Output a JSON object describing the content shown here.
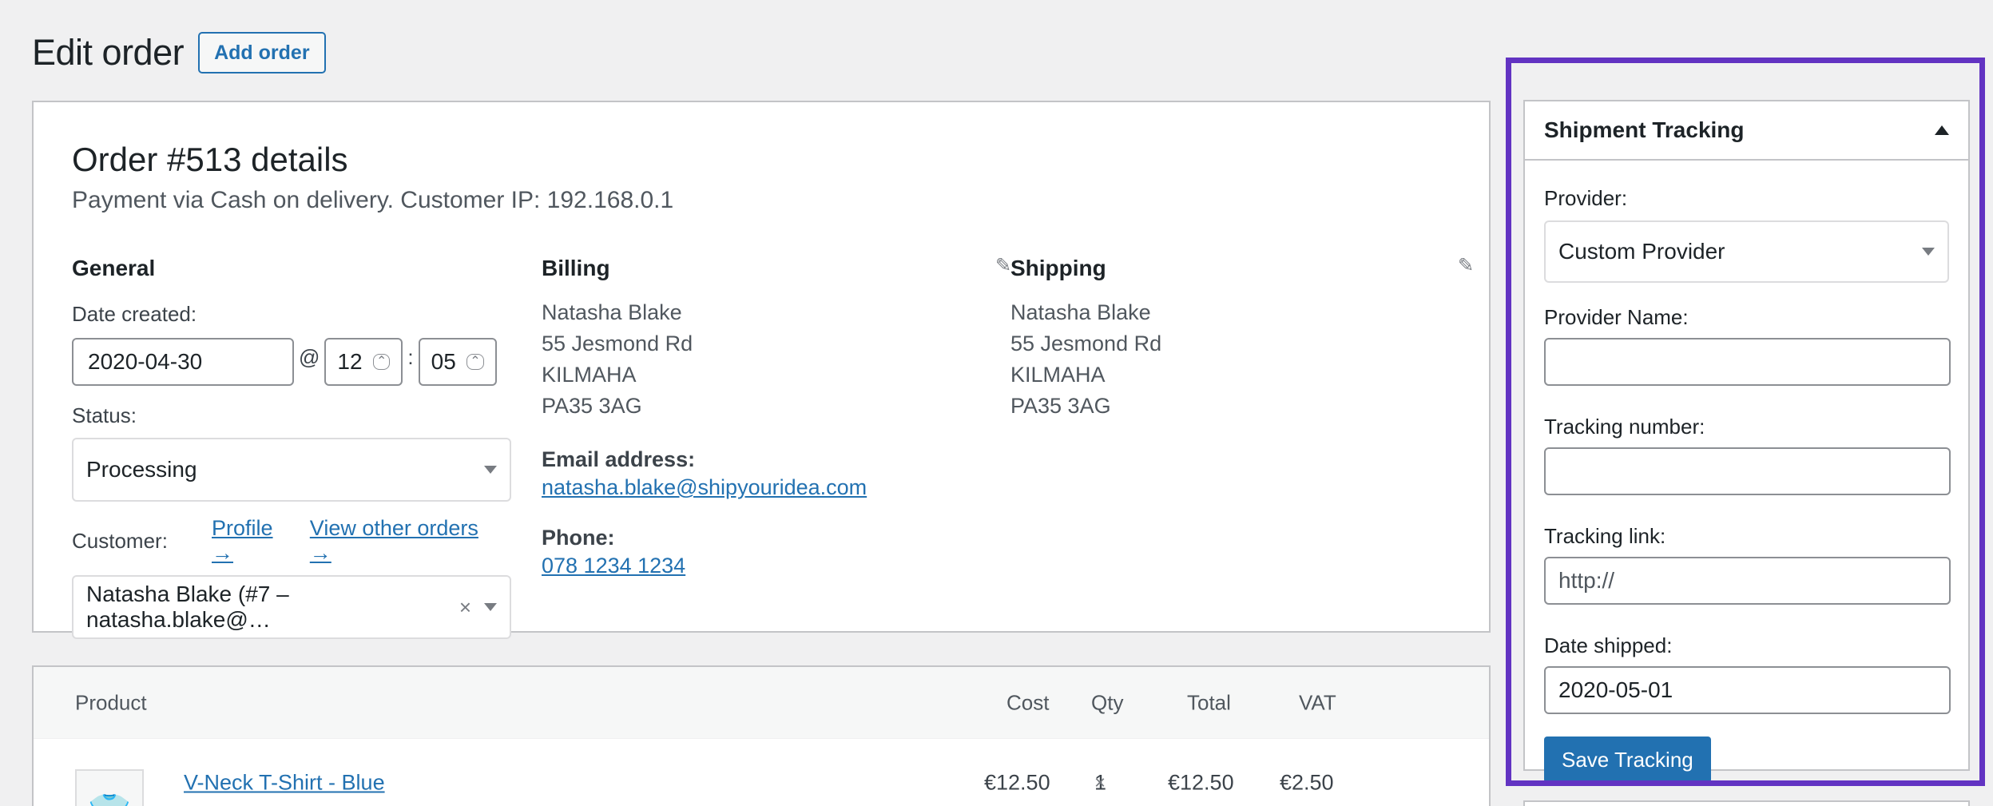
{
  "header": {
    "title": "Edit order",
    "add_order_label": "Add order"
  },
  "order": {
    "heading": "Order #513 details",
    "subtitle": "Payment via Cash on delivery. Customer IP: 192.168.0.1",
    "general": {
      "title": "General",
      "date_label": "Date created:",
      "date_value": "2020-04-30",
      "at": "@",
      "hour": "12",
      "colon": ":",
      "minute": "05",
      "status_label": "Status:",
      "status_value": "Processing",
      "customer_label": "Customer:",
      "profile_link": "Profile →",
      "other_orders_link": "View other orders →",
      "customer_value": "Natasha Blake (#7 – natasha.blake@…",
      "clear_glyph": "×"
    },
    "billing": {
      "title": "Billing",
      "address": [
        "Natasha Blake",
        "55 Jesmond Rd",
        "KILMAHA",
        "PA35 3AG"
      ],
      "email_label": "Email address:",
      "email": "natasha.blake@shipyouridea.com",
      "phone_label": "Phone:",
      "phone": "078 1234 1234"
    },
    "shipping": {
      "title": "Shipping",
      "address": [
        "Natasha Blake",
        "55 Jesmond Rd",
        "KILMAHA",
        "PA35 3AG"
      ]
    }
  },
  "items": {
    "columns": {
      "product": "Product",
      "cost": "Cost",
      "qty": "Qty",
      "total": "Total",
      "vat": "VAT"
    },
    "rows": [
      {
        "name": "V-Neck T-Shirt - Blue",
        "cost": "€12.50",
        "times": "×",
        "qty": "1",
        "total": "€12.50",
        "vat": "€2.50"
      }
    ]
  },
  "tracking": {
    "title": "Shipment Tracking",
    "provider_label": "Provider:",
    "provider_value": "Custom Provider",
    "provider_name_label": "Provider Name:",
    "provider_name_value": "",
    "tracking_number_label": "Tracking number:",
    "tracking_number_value": "",
    "tracking_link_label": "Tracking link:",
    "tracking_link_placeholder": "http://",
    "date_shipped_label": "Date shipped:",
    "date_shipped_value": "2020-05-01",
    "save_label": "Save Tracking"
  },
  "colors": {
    "accent": "#2271b1",
    "highlight": "#6233c2",
    "background": "#f0f0f1"
  },
  "icons": {
    "edit": "pencil-icon",
    "collapse": "triangle-up-icon",
    "dropdown": "caret-down-icon",
    "product_thumb": "t-shirt-icon"
  }
}
